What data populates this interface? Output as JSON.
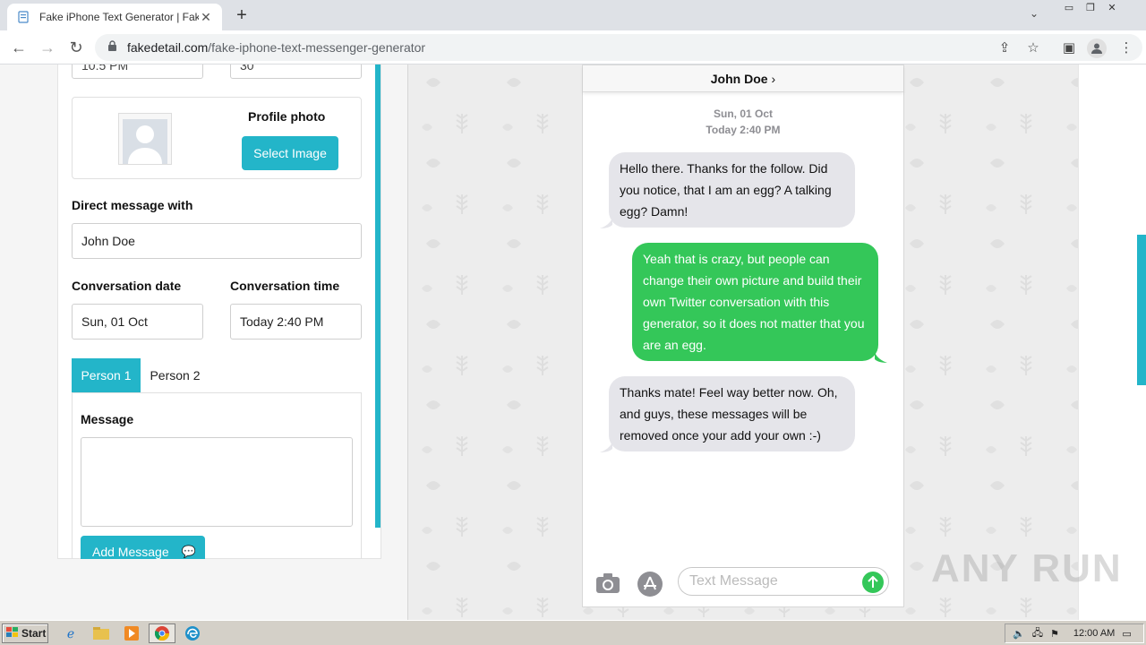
{
  "browser": {
    "tab_title": "Fake iPhone Text Generator | Fake T",
    "url_domain": "fakedetail.com",
    "url_path": "/fake-iphone-text-messenger-generator"
  },
  "form": {
    "top_left_value": "10:5 PM",
    "top_right_value": "30",
    "profile_photo_label": "Profile photo",
    "select_image_label": "Select Image",
    "dm_label": "Direct message with",
    "dm_value": "John Doe",
    "date_label": "Conversation date",
    "date_value": "Sun, 01 Oct",
    "time_label": "Conversation time",
    "time_value": "Today 2:40 PM",
    "person1_tab": "Person 1",
    "person2_tab": "Person 2",
    "message_label": "Message",
    "message_value": "",
    "add_message_label": "Add Message"
  },
  "phone": {
    "contact_name": "John Doe",
    "date_line": "Sun, 01 Oct",
    "time_line": "Today 2:40 PM",
    "messages": [
      {
        "side": "in",
        "text": "Hello there. Thanks for the follow. Did you notice, that I am an egg? A talking egg? Damn!"
      },
      {
        "side": "out",
        "text": "Yeah that is crazy, but people can change their own picture and build their own Twitter conversation with this generator, so it does not matter that you are an egg."
      },
      {
        "side": "in",
        "text": "Thanks mate! Feel way better now. Oh, and guys, these messages will be removed once your add your own :-)"
      }
    ],
    "input_placeholder": "Text Message"
  },
  "watermark": "ANY RUN",
  "taskbar": {
    "start_label": "Start",
    "clock": "12:00 AM"
  },
  "colors": {
    "accent": "#23b5c9",
    "imessage_green": "#34c759",
    "incoming_gray": "#e5e5ea"
  }
}
